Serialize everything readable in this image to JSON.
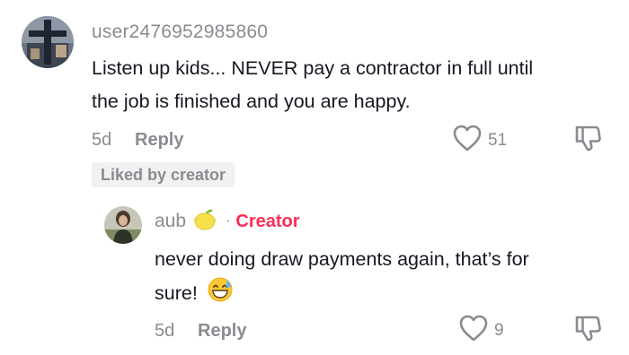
{
  "comment": {
    "username": "user2476952985860",
    "text_line1": "Listen up kids... NEVER pay a contractor in full until",
    "text_line2": "the job is finished and you are happy.",
    "time": "5d",
    "reply_label": "Reply",
    "like_count": "51",
    "liked_badge": "Liked by creator"
  },
  "reply": {
    "username": "aub",
    "username_emoji": "lemon",
    "creator_label": "Creator",
    "separator": "·",
    "text_line1": "never doing draw payments again, that’s for",
    "text_line2": "sure!",
    "text_emoji": "grinning-face-with-sweat",
    "time": "5d",
    "reply_label": "Reply",
    "like_count": "9"
  },
  "colors": {
    "muted": "#8a8b91",
    "text": "#161823",
    "creator": "#fe2c55",
    "badge_bg": "#f1f1f2"
  }
}
